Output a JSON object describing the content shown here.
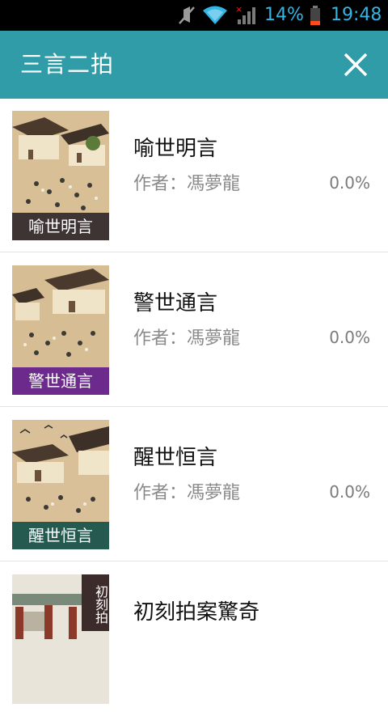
{
  "status_bar": {
    "battery": "14%",
    "time": "19:48",
    "icons": [
      "mute-icon",
      "wifi-icon",
      "signal-icon",
      "battery-icon"
    ]
  },
  "app_bar": {
    "title": "三言二拍",
    "close_icon": "close-icon"
  },
  "books": [
    {
      "title": "喻世明言",
      "author": "作者：馮夢龍",
      "progress": "0.0%",
      "cover_label": "喻世明言",
      "label_color": "#3d3433"
    },
    {
      "title": "警世通言",
      "author": "作者：馮夢龍",
      "progress": "0.0%",
      "cover_label": "警世通言",
      "label_color": "#6b2a8c"
    },
    {
      "title": "醒世恒言",
      "author": "作者：馮夢龍",
      "progress": "0.0%",
      "cover_label": "醒世恒言",
      "label_color": "#245a4f"
    },
    {
      "title": "初刻拍案驚奇",
      "cover_label_vertical": "初刻拍"
    }
  ],
  "colors": {
    "app_bar": "#2f9ca8",
    "status_text": "#33b5e5"
  }
}
